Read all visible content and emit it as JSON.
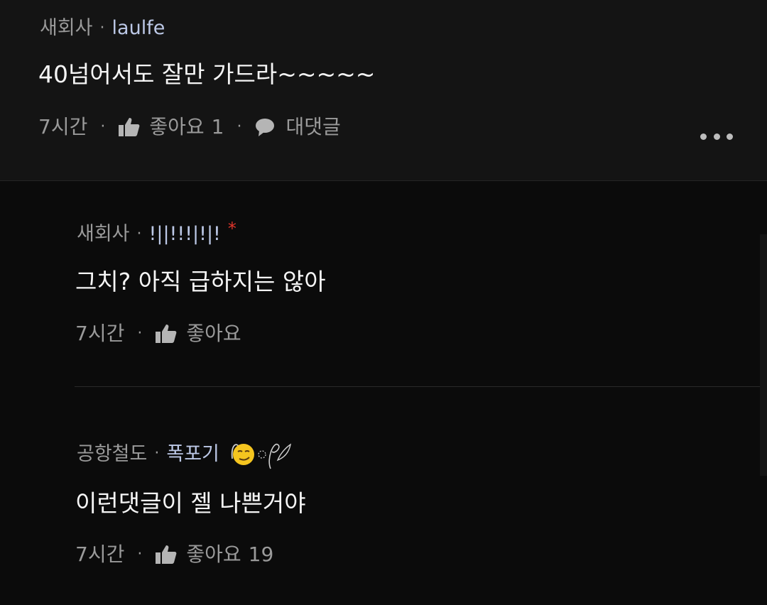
{
  "comments": [
    {
      "board": "새회사",
      "separator": "·",
      "nickname": "laulfe",
      "text": "40넘어서도 잘만 가드라~~~~~",
      "time": "7시간",
      "like_label": "좋아요",
      "like_count": "1",
      "reply_label": "대댓글"
    },
    {
      "board": "새회사",
      "separator": "·",
      "nickname": "!||!!!|!|!",
      "author_mark": "*",
      "text": "그치? 아직 급하지는 않아",
      "time": "7시간",
      "like_label": "좋아요",
      "like_count": ""
    },
    {
      "board": "공항철도",
      "separator": "·",
      "nickname": "폭포기",
      "text": "이런댓글이 젤 나쁜거야",
      "time": "7시간",
      "like_label": "좋아요",
      "like_count": "19"
    }
  ],
  "icons": {
    "like": "thumbs-up-icon",
    "reply": "speech-bubble-icon",
    "more": "more-dots-icon",
    "nickname_deco": "smirk-emoji-icon"
  },
  "colors": {
    "background": "#0b0b0b",
    "top_comment_background": "#141414",
    "nickname": "#bcc8e6",
    "meta_gray": "#9a9a9a",
    "required_mark": "#e0352b"
  }
}
